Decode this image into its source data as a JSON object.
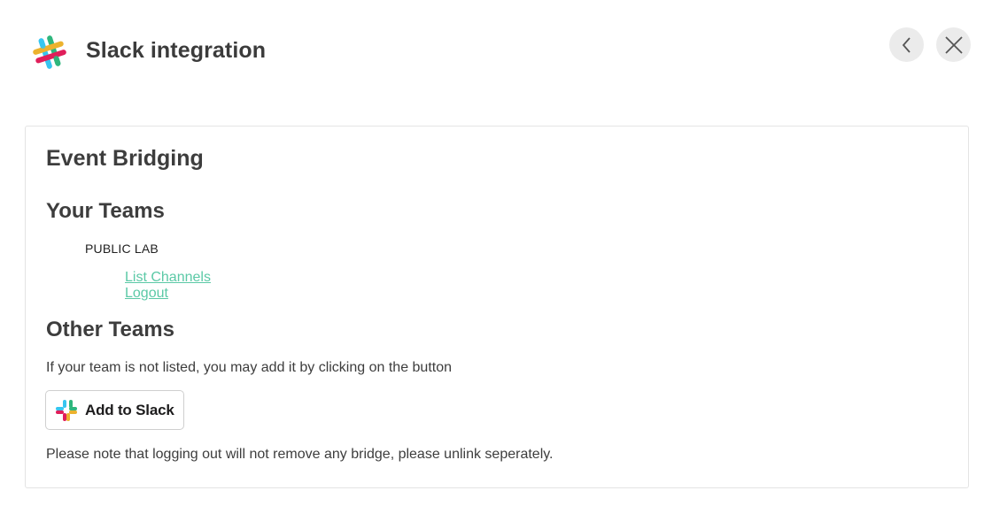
{
  "header": {
    "title": "Slack integration",
    "logo_icon": "slack-logo-icon",
    "back_icon": "chevron-left-icon",
    "close_icon": "close-icon",
    "button_bg": "#ebebeb"
  },
  "main": {
    "heading": "Event Bridging",
    "your_teams": {
      "heading": "Your Teams",
      "teams": [
        {
          "name": "PUBLIC LAB",
          "links": [
            "List Channels",
            "Logout"
          ]
        }
      ]
    },
    "other_teams": {
      "heading": "Other Teams",
      "instruction": "If your team is not listed, you may add it by clicking on the button",
      "add_button": {
        "prefix": "Add to",
        "brand": "Slack",
        "icon": "slack-logo-icon"
      },
      "note": "Please note that logging out will not remove any bridge, please unlink seperately."
    }
  },
  "colors": {
    "link": "#5bc9a6",
    "text": "#3d3d3d",
    "card_border": "#e4e4e4"
  }
}
